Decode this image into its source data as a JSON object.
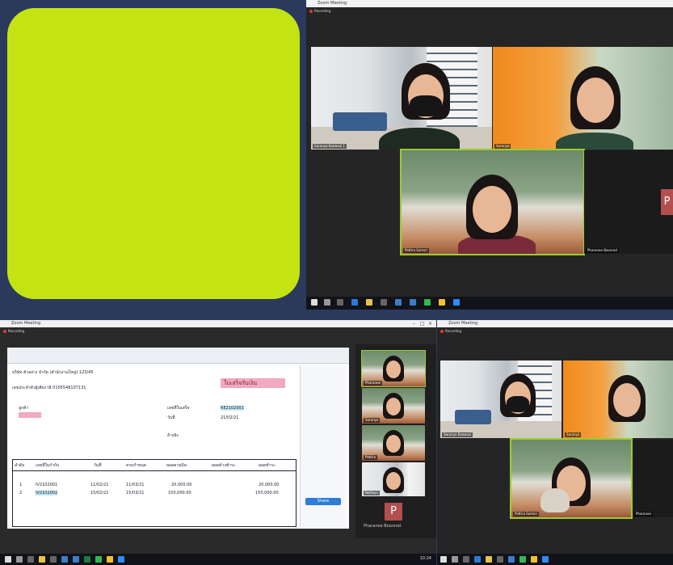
{
  "colors": {
    "background": "#2b3a5c",
    "card": "#c4e313",
    "zoom_bg": "#252525",
    "pdf_highlight": "#f0a9c0",
    "avatar": "#b34f4f",
    "recording": "#e53935"
  },
  "top_right": {
    "window_title": "Zoom Meeting",
    "recording": "Recording",
    "tiles": [
      {
        "name": "Saranya Kaewsai 1"
      },
      {
        "name": "Saranya"
      },
      {
        "name": "Pattira Somsri"
      },
      {
        "name": "Pharanee Boonrod"
      }
    ],
    "side_avatar": "P"
  },
  "bottom_left": {
    "window_title": "Zoom Meeting",
    "recording": "Recording",
    "pdf": {
      "heading_line1": "ใบเสร็จรับเงิน",
      "company_line": "บริษัท ตัวอย่าง จำกัด (สำนักงานใหญ่) 123/45",
      "tax_line": "เลขประจำตัวผู้เสียภาษี 0105548107131",
      "customer_label": "ลูกค้า",
      "doc_no_label": "เลขที่ใบเสร็จ",
      "doc_no": "RE2102001",
      "date_label": "วันที่",
      "date": "21/02/21",
      "ref_label": "อ้างอิง",
      "table_headers": [
        "ลำดับ",
        "เลขที่ใบกำกับ",
        "วันที่",
        "ครบกำหนด",
        "ยอดตามบิล",
        "ยอดค้างชำระ",
        "ยอดชำระ"
      ],
      "rows": [
        [
          "1",
          "IV2102001",
          "11/02/21",
          "11/03/21",
          "20,000.00",
          "",
          "20,000.00"
        ],
        [
          "2",
          "IV2102002",
          "15/02/21",
          "15/03/21",
          "150,000.00",
          "",
          "150,000.00"
        ]
      ],
      "panel_button": "Share"
    },
    "strip_tiles": [
      {
        "name": "Pharanee"
      },
      {
        "name": "Saranya"
      },
      {
        "name": "Pattira"
      },
      {
        "name": "Nattaya"
      }
    ],
    "avatar_letter": "P",
    "avatar_name": "Pharanee Boonrod",
    "taskbar_time": "10:24"
  },
  "bottom_right": {
    "window_title": "Zoom Meeting",
    "recording": "Recording",
    "tiles": [
      {
        "name": "Saranya Kaewsai"
      },
      {
        "name": "Saranya"
      },
      {
        "name": "Pattira Somsri"
      },
      {
        "name": "Pharanee"
      }
    ]
  }
}
